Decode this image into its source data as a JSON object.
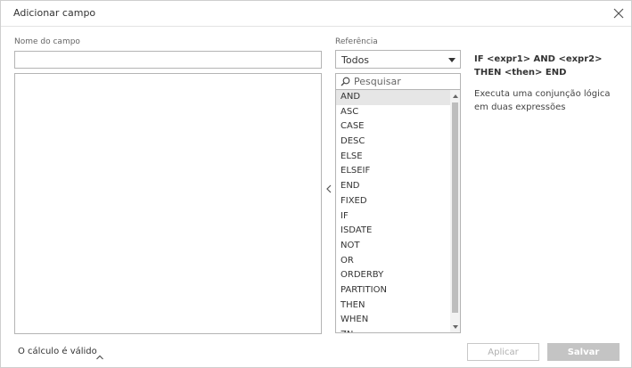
{
  "dialog": {
    "title": "Adicionar campo"
  },
  "form": {
    "name_label": "Nome do campo",
    "name_value": "",
    "formula_value": ""
  },
  "reference": {
    "label": "Referência",
    "selected": "Todos",
    "search_placeholder": "Pesquisar",
    "functions": [
      "AND",
      "ASC",
      "CASE",
      "DESC",
      "ELSE",
      "ELSEIF",
      "END",
      "FIXED",
      "IF",
      "ISDATE",
      "NOT",
      "OR",
      "ORDERBY",
      "PARTITION",
      "THEN",
      "WHEN",
      "ZN"
    ],
    "selected_function": "AND"
  },
  "help": {
    "syntax": "IF <expr1> AND <expr2> THEN <then> END",
    "description": "Executa uma conjunção lógica em duas expressões"
  },
  "footer": {
    "status": "O cálculo é válido",
    "apply_label": "Aplicar",
    "save_label": "Salvar"
  },
  "icons": {
    "close": "close-icon",
    "collapse": "chevron-left-icon",
    "search": "search-icon",
    "status_toggle": "chevron-up-icon"
  },
  "colors": {
    "selected_row": "#e6e6e6",
    "disabled_button": "#c4c4c4"
  }
}
